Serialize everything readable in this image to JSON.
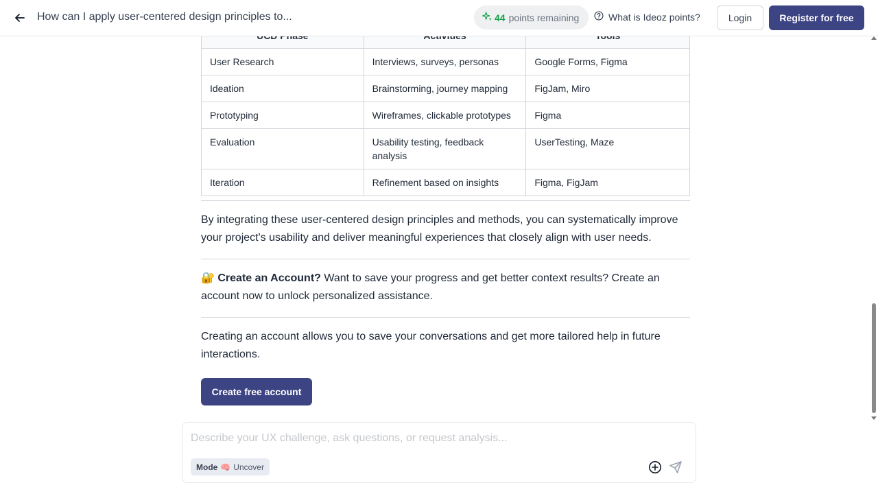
{
  "header": {
    "title": "How can I apply user-centered design principles to...",
    "points_value": "44",
    "points_label": "points remaining",
    "what_is_label": "What is Ideoz points?",
    "login_label": "Login",
    "register_label": "Register for free"
  },
  "table": {
    "headers": [
      "UCD Phase",
      "Activities",
      "Tools"
    ],
    "rows": [
      [
        "User Research",
        "Interviews, surveys, personas",
        "Google Forms, Figma"
      ],
      [
        "Ideation",
        "Brainstorming, journey mapping",
        "FigJam, Miro"
      ],
      [
        "Prototyping",
        "Wireframes, clickable prototypes",
        "Figma"
      ],
      [
        "Evaluation",
        "Usability testing, feedback analysis",
        "UserTesting, Maze"
      ],
      [
        "Iteration",
        "Refinement based on insights",
        "Figma, FigJam"
      ]
    ]
  },
  "summary": "By integrating these user-centered design principles and methods, you can systematically improve your project's usability and deliver meaningful experiences that closely align with user needs.",
  "account_prompt": {
    "emoji": "🔐",
    "heading": "Create an Account?",
    "text": " Want to save your progress and get better context results? Create an account now to unlock personalized assistance."
  },
  "account_info": "Creating an account allows you to save your conversations and get more tailored help in future interactions.",
  "create_button_label": "Create free account",
  "composer": {
    "placeholder": "Describe your UX challenge, ask questions, or request analysis...",
    "mode_label": "Mode",
    "mode_emoji": "🧠",
    "mode_value": "Uncover"
  },
  "colors": {
    "primary": "#3d4483",
    "points_green": "#16a34a"
  }
}
